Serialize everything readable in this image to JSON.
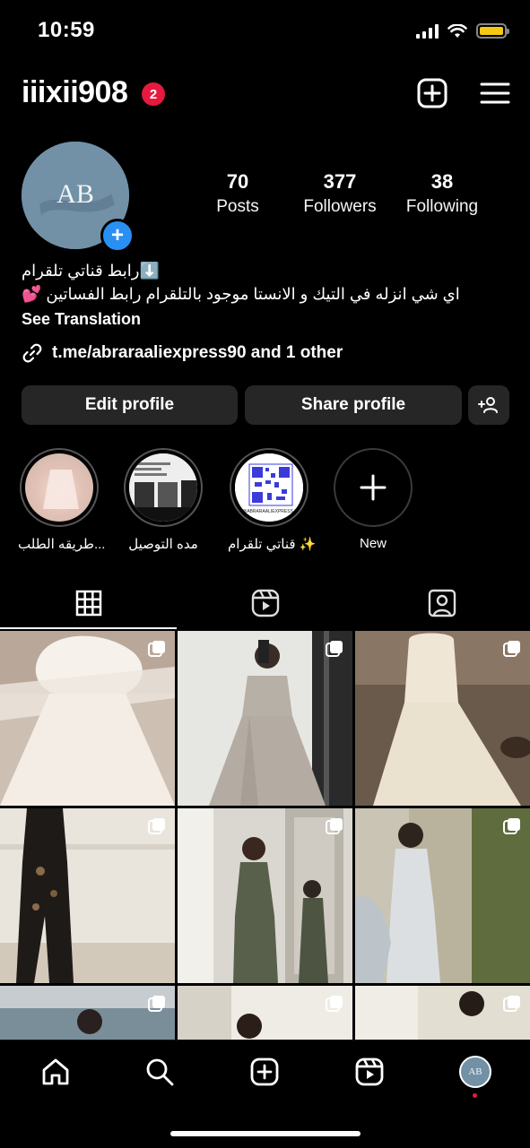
{
  "status": {
    "time": "10:59"
  },
  "header": {
    "username": "iiixii908",
    "notification_count": "2"
  },
  "profile": {
    "avatar_text": "AB",
    "posts_count": "70",
    "posts_label": "Posts",
    "followers_count": "377",
    "followers_label": "Followers",
    "following_count": "38",
    "following_label": "Following",
    "bio_line1": "رابط قناتي تلقرام⬇️",
    "bio_line2": "اي شي انزله في التيك و الانستا موجود بالتلقرام رابط الفساتين 💕",
    "see_translation": "See Translation",
    "link_text": "t.me/abraraaliexpress90 and 1 other"
  },
  "buttons": {
    "edit_profile": "Edit profile",
    "share_profile": "Share profile"
  },
  "highlights": [
    {
      "label": "طريقه الطلب..."
    },
    {
      "label": "مده التوصيل"
    },
    {
      "label": "قناتي تلقرام ✨",
      "qr_caption": "@ABRARAALIEXPRESS 90"
    },
    {
      "label": "New"
    }
  ],
  "tabs": [
    "grid-tab",
    "reels-tab",
    "tagged-tab"
  ],
  "colors": {
    "accent_blue": "#2a8ff2",
    "badge_red": "#e6193f",
    "button_bg": "#262626",
    "battery": "#f4c815"
  }
}
